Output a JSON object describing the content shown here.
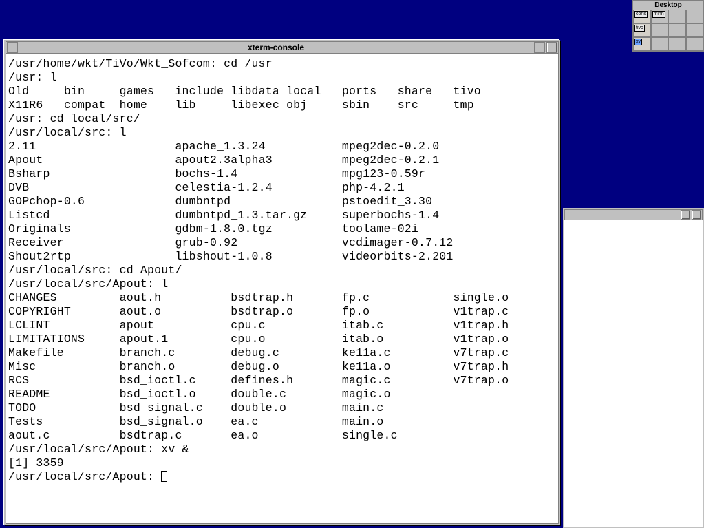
{
  "pager": {
    "label": "Desktop",
    "minis": [
      "cons",
      "minn",
      "tivo",
      "xv"
    ]
  },
  "window": {
    "title": "xterm-console"
  },
  "terminal": {
    "lines": [
      "/usr/home/wkt/TiVo/Wkt_Sofcom: cd /usr",
      "/usr: l",
      "Old     bin     games   include libdata local   ports   share   tivo",
      "X11R6   compat  home    lib     libexec obj     sbin    src     tmp",
      "/usr: cd local/src/",
      "/usr/local/src: l",
      "2.11                    apache_1.3.24           mpeg2dec-0.2.0",
      "Apout                   apout2.3alpha3          mpeg2dec-0.2.1",
      "Bsharp                  bochs-1.4               mpg123-0.59r",
      "DVB                     celestia-1.2.4          php-4.2.1",
      "GOPchop-0.6             dumbntpd                pstoedit_3.30",
      "Listcd                  dumbntpd_1.3.tar.gz     superbochs-1.4",
      "Originals               gdbm-1.8.0.tgz          toolame-02i",
      "Receiver                grub-0.92               vcdimager-0.7.12",
      "Shout2rtp               libshout-1.0.8          videorbits-2.201",
      "/usr/local/src: cd Apout/",
      "/usr/local/src/Apout: l",
      "CHANGES         aout.h          bsdtrap.h       fp.c            single.o",
      "COPYRIGHT       aout.o          bsdtrap.o       fp.o            v1trap.c",
      "LCLINT          apout           cpu.c           itab.c          v1trap.h",
      "LIMITATIONS     apout.1         cpu.o           itab.o          v1trap.o",
      "Makefile        branch.c        debug.c         ke11a.c         v7trap.c",
      "Misc            branch.o        debug.o         ke11a.o         v7trap.h",
      "RCS             bsd_ioctl.c     defines.h       magic.c         v7trap.o",
      "README          bsd_ioctl.o     double.c        magic.o",
      "TODO            bsd_signal.c    double.o        main.c",
      "Tests           bsd_signal.o    ea.c            main.o",
      "aout.c          bsdtrap.c       ea.o            single.c",
      "/usr/local/src/Apout: xv &",
      "[1] 3359"
    ],
    "prompt": "/usr/local/src/Apout: "
  }
}
